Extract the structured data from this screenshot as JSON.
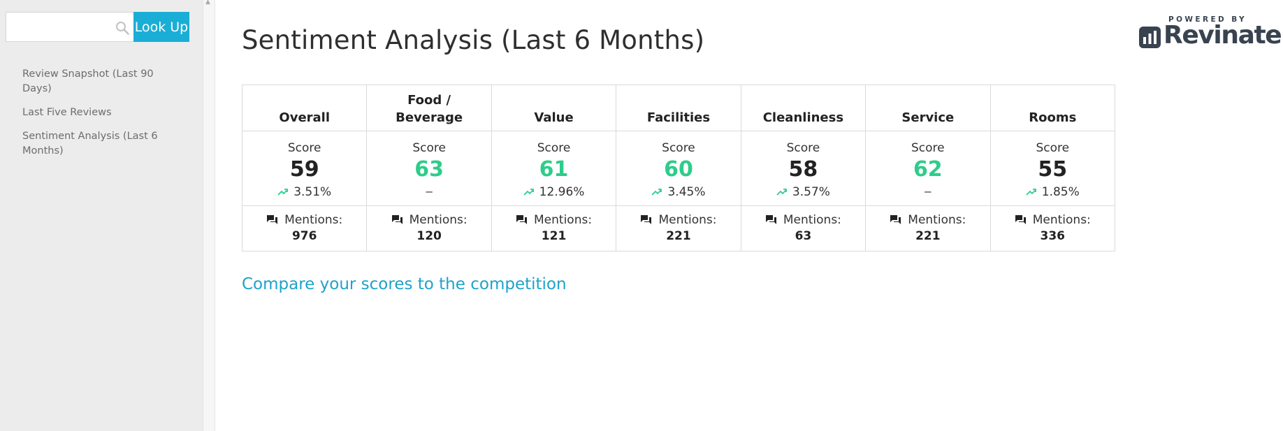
{
  "sidebar": {
    "search": {
      "value": "",
      "placeholder": ""
    },
    "lookup_label": "Look Up",
    "nav_items": [
      {
        "label": "Review Snapshot (Last 90 Days)"
      },
      {
        "label": "Last Five Reviews"
      },
      {
        "label": "Sentiment Analysis (Last 6 Months)"
      }
    ]
  },
  "header": {
    "title": "Sentiment Analysis (Last 6 Months)",
    "powered_by": "POWERED BY",
    "brand": "Revinate"
  },
  "table": {
    "score_label": "Score",
    "mentions_label": "Mentions:",
    "columns": [
      {
        "name": "Overall",
        "score": "59",
        "score_color": "#222222",
        "trend": "3.51%",
        "mentions": "976"
      },
      {
        "name": "Food / Beverage",
        "score": "63",
        "score_color": "#2ecc8a",
        "trend": "–",
        "mentions": "120"
      },
      {
        "name": "Value",
        "score": "61",
        "score_color": "#2ecc8a",
        "trend": "12.96%",
        "mentions": "121"
      },
      {
        "name": "Facilities",
        "score": "60",
        "score_color": "#2ecc8a",
        "trend": "3.45%",
        "mentions": "221"
      },
      {
        "name": "Cleanliness",
        "score": "58",
        "score_color": "#222222",
        "trend": "3.57%",
        "mentions": "63"
      },
      {
        "name": "Service",
        "score": "62",
        "score_color": "#2ecc8a",
        "trend": "–",
        "mentions": "221"
      },
      {
        "name": "Rooms",
        "score": "55",
        "score_color": "#222222",
        "trend": "1.85%",
        "mentions": "336"
      }
    ]
  },
  "compare_link": "Compare your scores to the competition",
  "colors": {
    "accent": "#1aaed6",
    "link": "#1fa2c9",
    "positive": "#2ecc8a"
  },
  "icons": {
    "search": "magnifier-icon",
    "trend": "trending-up-icon",
    "mentions": "chat-bubbles-icon"
  }
}
